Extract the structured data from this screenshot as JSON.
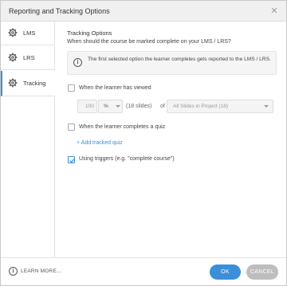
{
  "window": {
    "title": "Reporting and Tracking Options",
    "close_glyph": "✕"
  },
  "sidebar": {
    "items": [
      {
        "label": "LMS",
        "icon": "gear-icon",
        "active": false
      },
      {
        "label": "LRS",
        "icon": "gear-icon",
        "active": false
      },
      {
        "label": "Tracking",
        "icon": "gear-icon",
        "active": true
      }
    ]
  },
  "tracking": {
    "heading": "Tracking Options",
    "question": "When should the course be marked complete on your LMS / LRS?",
    "info_icon_glyph": "i",
    "info_text": "The first selected option the learner completes gets reported to the LMS / LRS.",
    "option_viewed": {
      "label": "When the learner has viewed",
      "checked": false
    },
    "viewed_amount": "100",
    "viewed_unit": "%",
    "slides_count": "(18 slides)",
    "of_label": "of",
    "slide_scope": "All Slides in Project (18)",
    "option_quiz": {
      "label": "When the learner completes a quiz",
      "checked": false
    },
    "add_quiz_link": "+ Add tracked quiz",
    "option_triggers": {
      "label": "Using triggers (e.g. \"complete course\")",
      "checked": true
    }
  },
  "footer": {
    "learn_icon_glyph": "i",
    "learn_more": "LEARN MORE...",
    "ok_label": "OK",
    "cancel_label": "CANCEL"
  },
  "colors": {
    "accent": "#3b8fd8",
    "cancel": "#bdbdbd",
    "titlebar": "#f0f0f0"
  }
}
